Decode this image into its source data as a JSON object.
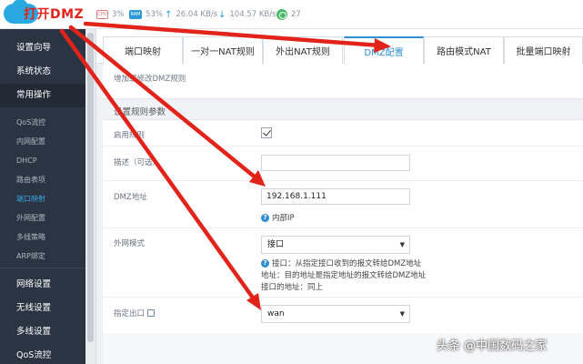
{
  "logo": {
    "text": "打开DMZ"
  },
  "status": {
    "cpu": "3%",
    "ram": "53%",
    "upload": "26.04 KB/s",
    "download": "104.57 KB/s",
    "connections": "27",
    "cpu_icon_label": "CPU",
    "ram_icon_label": "RAM"
  },
  "sidebar": {
    "main_top": [
      {
        "label": "设置向导"
      },
      {
        "label": "系统状态"
      },
      {
        "label": "常用操作"
      }
    ],
    "sub_items": [
      {
        "label": "QoS流控"
      },
      {
        "label": "内网配置"
      },
      {
        "label": "DHCP"
      },
      {
        "label": "路由表项"
      },
      {
        "label": "端口映射"
      },
      {
        "label": "外网配置"
      },
      {
        "label": "多线策略"
      },
      {
        "label": "ARP绑定"
      }
    ],
    "main_bottom": [
      {
        "label": "网络设置"
      },
      {
        "label": "无线设置"
      },
      {
        "label": "多线设置"
      },
      {
        "label": "QoS流控"
      }
    ]
  },
  "tabs": [
    {
      "label": "端口映射"
    },
    {
      "label": "一对一NAT规则"
    },
    {
      "label": "外出NAT规则"
    },
    {
      "label": "DMZ配置"
    },
    {
      "label": "路由模式NAT"
    },
    {
      "label": "批量端口映射"
    }
  ],
  "content": {
    "breadcrumb": "增加或修改DMZ规则",
    "section_title": "设置规则参数",
    "enable_label": "启用规则",
    "desc_label": "描述（可选）",
    "desc_value": "",
    "dmz_label": "DMZ地址",
    "dmz_value": "192.168.1.111",
    "dmz_hint": "内部IP",
    "wan_mode_label": "外网模式",
    "wan_mode_value": "接口",
    "wan_mode_hints": [
      "接口：从指定接口收到的报文转给DMZ地址",
      "地址：目的地址是指定地址的报文转给DMZ地址",
      "接口的地址：同上"
    ],
    "out_iface_label": "指定出口",
    "out_iface_value": "wan"
  },
  "watermark": "头条 @中国数码之家",
  "colors": {
    "sidebar_bg": "#2b3443",
    "accent": "#2f8fd4",
    "arrow": "#e2231a"
  }
}
